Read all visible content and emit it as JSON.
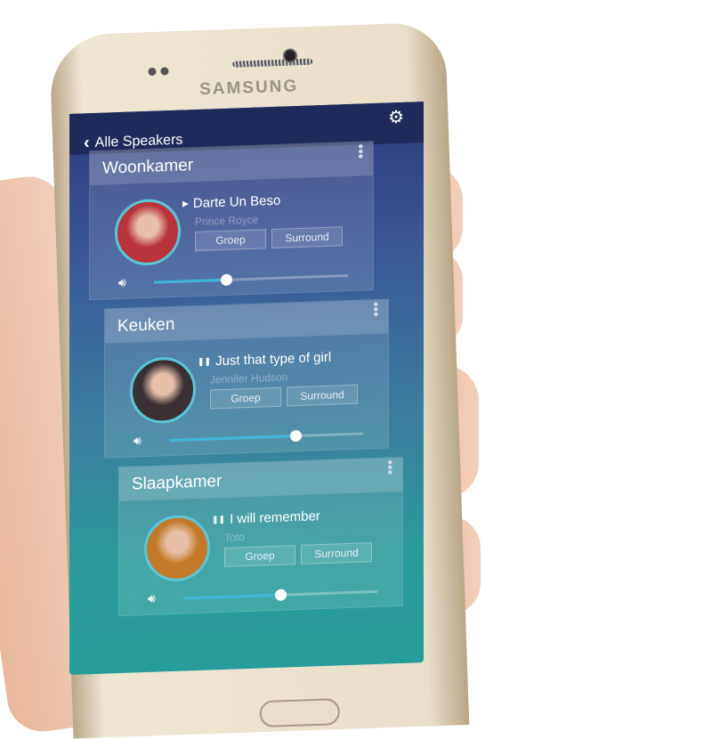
{
  "device": {
    "brand": "SAMSUNG"
  },
  "header": {
    "back_label": "Alle Speakers",
    "back_icon": "chevron-left-icon",
    "settings_icon": "gear-icon"
  },
  "colors": {
    "topbar": "#1f2a5a",
    "accent": "#3fb6d9",
    "screen_top": "#2c3a78",
    "screen_bottom": "#279c9b"
  },
  "rooms": [
    {
      "name": "Woonkamer",
      "state": "playing",
      "title": "Darte Un Beso",
      "artist": "Prince Royce",
      "group_label": "Groep",
      "surround_label": "Surround",
      "volume": 0.37,
      "art_color": "#b8333a"
    },
    {
      "name": "Keuken",
      "state": "paused",
      "title": "Just that type of girl",
      "artist": "Jennifer Hudson",
      "group_label": "Groep",
      "surround_label": "Surround",
      "volume": 0.65,
      "art_color": "#3a2f33"
    },
    {
      "name": "Slaapkamer",
      "state": "paused",
      "title": "I will remember",
      "artist": "Toto",
      "group_label": "Groep",
      "surround_label": "Surround",
      "volume": 0.5,
      "art_color": "#c27a2a"
    }
  ]
}
